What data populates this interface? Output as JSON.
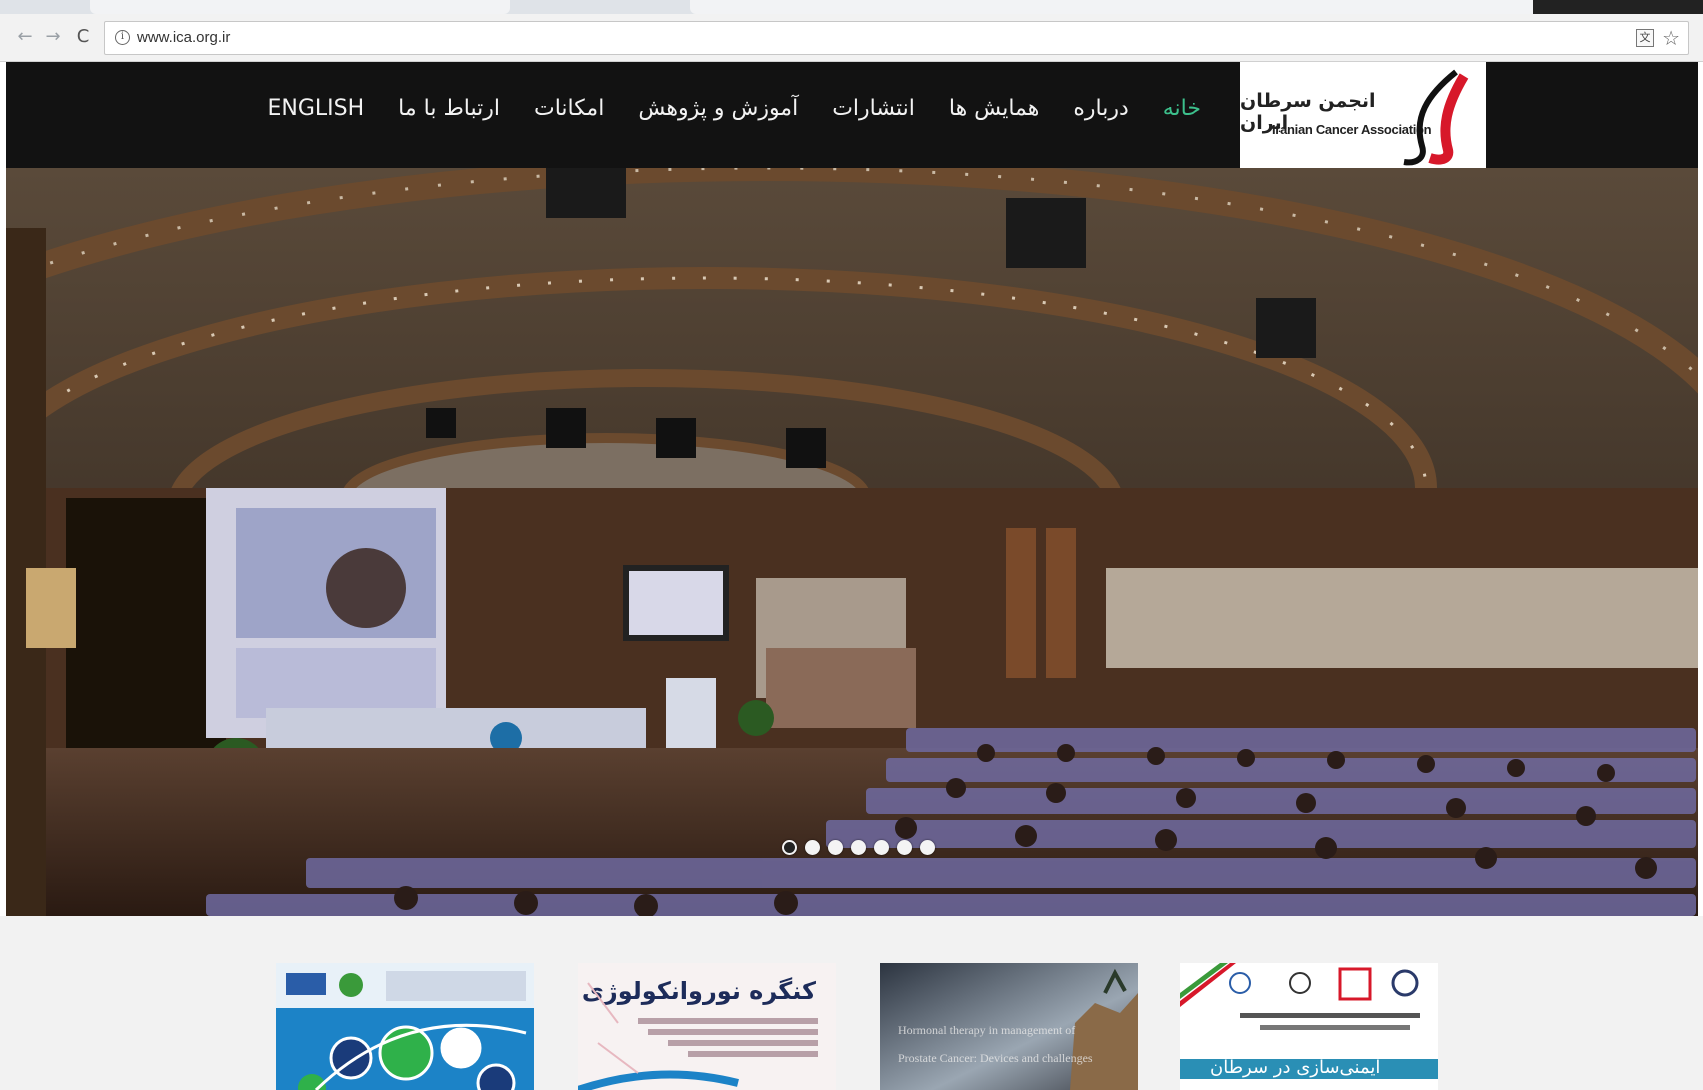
{
  "browser": {
    "url": "www.ica.org.ir",
    "back_label": "←",
    "forward_label": "→",
    "reload_label": "C",
    "info_label": "i",
    "translate_label": "文",
    "star_label": "☆"
  },
  "logo": {
    "fa": "انجمن سرطان ایران",
    "en": "Iranian Cancer Association"
  },
  "nav": {
    "items": [
      {
        "label": "خانه",
        "active": true
      },
      {
        "label": "درباره"
      },
      {
        "label": "همایش ها"
      },
      {
        "label": "انتشارات"
      },
      {
        "label": "آموزش و پژوهش"
      },
      {
        "label": "امکانات"
      },
      {
        "label": "ارتباط با ما"
      },
      {
        "label": "ENGLISH"
      }
    ]
  },
  "slider": {
    "dot_count": 7,
    "active_index": 0
  },
  "cards": {
    "card2_title": "کنگره نوروانکولوژی ایران",
    "card3_line1": "Hormonal therapy in management of",
    "card3_line2": "Prostate Cancer: Devices and challenges",
    "card4_band": "ایمنی‌سازی در سرطان"
  },
  "colors": {
    "header_bg": "#121212",
    "active_menu": "#3cc08c",
    "logo_red": "#d7182a"
  }
}
